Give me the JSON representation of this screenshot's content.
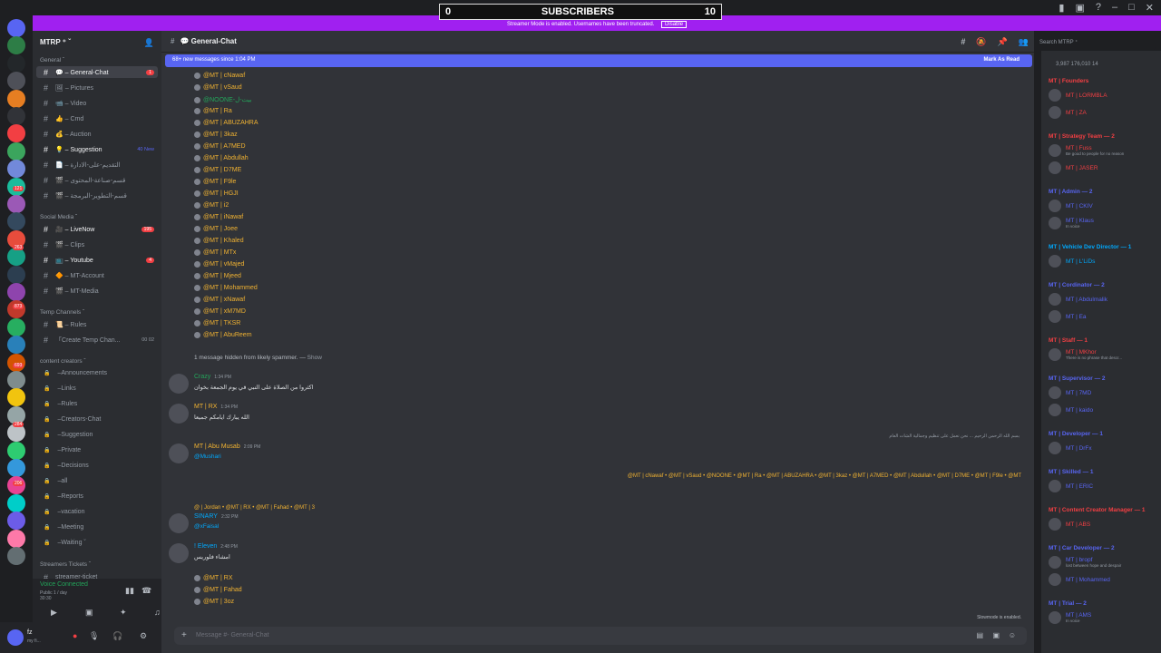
{
  "overlay": {
    "left_count": "0",
    "title": "SUBSCRIBERS",
    "right_count": "10"
  },
  "banner": {
    "text": "Streamer Mode is enabled. Usernames have been truncated.",
    "action": "Disable"
  },
  "guild_badges": [
    "121",
    "263",
    "873",
    "693",
    "284",
    "206"
  ],
  "guild_letters": [
    "F.",
    "fs"
  ],
  "server": {
    "name": "MTRP ⁺ ˇ"
  },
  "categories": {
    "general": "General ˇ",
    "social": "Social Media ˇ",
    "temp": "Temp Channels ˇ",
    "creators": "content creators ˇ",
    "streamers": "Streamers Tickets ˇ"
  },
  "channels_general": [
    {
      "label": "💬 – General-Chat",
      "badge": "1"
    },
    {
      "label": "🖼 – Pictures",
      "badge": ""
    },
    {
      "label": "📹 – Video",
      "badge": ""
    },
    {
      "label": "👍 – Cmd",
      "badge": ""
    },
    {
      "label": "💰 – Auction",
      "badge": ""
    },
    {
      "label": "💡 – Suggestion",
      "new": "40 New"
    },
    {
      "label": "📄 – التقديم-على-الادارة",
      "badge": ""
    },
    {
      "label": "🎬 – قسم-صناعة-المحتوى",
      "badge": ""
    },
    {
      "label": "🎬 – قسم-التطوير-البرمجة",
      "badge": ""
    }
  ],
  "channels_social": [
    {
      "label": "🎥 – LiveNow",
      "badge": "195"
    },
    {
      "label": "🎬 – Clips",
      "badge": ""
    },
    {
      "label": "📺 – Youtube",
      "badge": "4"
    },
    {
      "label": "🔶 – MT-Account",
      "badge": ""
    },
    {
      "label": "🎬 – MT-Media",
      "badge": ""
    }
  ],
  "channels_temp": [
    {
      "label": "📜 – Rules"
    },
    {
      "label": "「Create Temp Chan...",
      "extra": "00 02"
    }
  ],
  "channels_creators": [
    "Announcements",
    "Links",
    "Rules",
    "Creators-Chat",
    "Suggestion",
    "Private",
    "Decisions",
    "all",
    "Reports",
    "vacation",
    "Meeting",
    "Waiting ˇ"
  ],
  "voice": {
    "status": "Voice Connected",
    "sub": "Public 1 / day",
    "sub2": "30:30",
    "streamers_ticket": "streamer-ticket"
  },
  "user": {
    "name": "fz",
    "status": "my fi..."
  },
  "header": {
    "channel": "💬 General-Chat"
  },
  "search": {
    "placeholder": "Search MTRP ⁺"
  },
  "new_messages": {
    "text": "68+ new messages since 1:04 PM",
    "action": "Mark As Read"
  },
  "mention_list": [
    "@MT | cNawaf",
    "@MT | vSaud",
    "@NOONE-بيت-ل",
    "@MT | Ra",
    "@MT | ABUZAHRA",
    "@MT | 3kaz",
    "@MT | A7MED",
    "@MT | Abdullah",
    "@MT | D7ME",
    "@MT | F9le",
    "@MT | HGJI",
    "@MT | i2",
    "@MT | iNawaf",
    "@MT | Joee",
    "@MT | Khaled",
    "@MT | MTx",
    "@MT | vMajed",
    "@MT | Mjeed",
    "@MT | Mohammed",
    "@MT | xNawaf",
    "@MT | xM7MD",
    "@MT | TKSR",
    "@MT | AbuReem"
  ],
  "hidden_msg": {
    "text": "1 message hidden from likely spammer. — ",
    "show": "Show"
  },
  "messages": [
    {
      "user": "Crazy",
      "time": "1:34 PM",
      "text": "اكثروا من الصلاة على النبي في يوم الجمعة بخوان"
    },
    {
      "user": "MT | RX",
      "time": "1:34 PM",
      "text": "الله يبارك ايامكم جميعا"
    },
    {
      "user": "MT | Abu Musab",
      "time": "2:09 PM",
      "text": "@Mushari"
    },
    {
      "user": "SINARY",
      "time": "2:32 PM",
      "text": "@xFaisal"
    },
    {
      "user": "! Eleven",
      "time": "2:48 PM",
      "text": "امشاء فلوريس"
    }
  ],
  "reply_line": "بسم الله الرحمن الرحيم ... نحن نعمل على تنظيم وجمالية الشات العام",
  "mention_row": "@MT | cNawaf  • @MT | vSaud  • @NOONE  • @MT | Ra  • @MT | ABUZAHRA  • @MT | 3kaz  • @MT | A7MED  • @MT | Abdullah  • @MT | D7ME  • @MT | F9le  • @MT",
  "reply_ref": "@ | Jordan  • @MT | RX  • @MT | Fahad  • @MT | 3",
  "bottom_mentions": [
    "@MT | RX",
    "@MT | Fahad",
    "@MT | 3oz"
  ],
  "input": {
    "placeholder": "Message #- General-Chat"
  },
  "slowmode": "Slowmode is enabled.",
  "members": {
    "stats": "3,987   176,010   14",
    "roles": [
      {
        "title": "MT | Founders",
        "list": [
          {
            "n": "MT | LORMBLA"
          },
          {
            "n": "MT | ZA"
          }
        ]
      },
      {
        "title": "MT | Strategy Team — 2",
        "list": [
          {
            "n": "MT | Fuss",
            "s": "Be good to people for no reason"
          },
          {
            "n": "MT | JASER"
          }
        ]
      },
      {
        "title": "MT | Admin — 2",
        "list": [
          {
            "n": "MT | CKIV"
          },
          {
            "n": "MT | Klaus",
            "s": "In voice"
          }
        ]
      },
      {
        "title": "MT | Vehicle Dev Director — 1",
        "list": [
          {
            "n": "MT | L'LiDs"
          }
        ]
      },
      {
        "title": "MT | Cordinator — 2",
        "list": [
          {
            "n": "MT | Abdulmalik"
          },
          {
            "n": "MT | Ea"
          }
        ]
      },
      {
        "title": "MT | Staff — 1",
        "list": [
          {
            "n": "MT | MKhor",
            "s": "There is no phrase that descr..."
          }
        ]
      },
      {
        "title": "MT | Supervisor — 2",
        "list": [
          {
            "n": "MT | 7MD"
          },
          {
            "n": "MT | kaido"
          }
        ]
      },
      {
        "title": "MT | Developer — 1",
        "list": [
          {
            "n": "MT | DrFx"
          }
        ]
      },
      {
        "title": "MT | Skilled — 1",
        "list": [
          {
            "n": "MT | ERIC"
          }
        ]
      },
      {
        "title": "MT | Content Creator Manager — 1",
        "list": [
          {
            "n": "MT | ABS"
          }
        ]
      },
      {
        "title": "MT | Car Developer — 2",
        "list": [
          {
            "n": "MT | bropf",
            "s": "lost between hope and despair"
          },
          {
            "n": "MT | Mohammed"
          }
        ]
      },
      {
        "title": "MT | Trial — 2",
        "list": [
          {
            "n": "MT | AMS",
            "s": "In voice"
          }
        ]
      }
    ]
  }
}
